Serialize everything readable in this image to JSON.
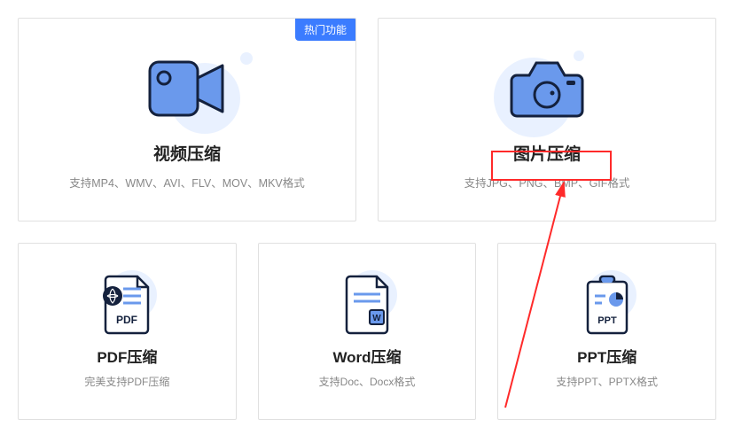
{
  "badge_hot": "热门功能",
  "cards": {
    "video": {
      "title": "视频压缩",
      "subtitle": "支持MP4、WMV、AVI、FLV、MOV、MKV格式"
    },
    "image": {
      "title": "图片压缩",
      "subtitle": "支持JPG、PNG、BMP、GIF格式"
    },
    "pdf": {
      "title": "PDF压缩",
      "subtitle": "完美支持PDF压缩",
      "icon_label": "PDF"
    },
    "word": {
      "title": "Word压缩",
      "subtitle": "支持Doc、Docx格式",
      "icon_label": "W"
    },
    "ppt": {
      "title": "PPT压缩",
      "subtitle": "支持PPT、PPTX格式",
      "icon_label": "PPT"
    }
  },
  "colors": {
    "accent": "#5b8def",
    "accent_dark": "#14213d",
    "highlight": "#ff2a2a"
  }
}
